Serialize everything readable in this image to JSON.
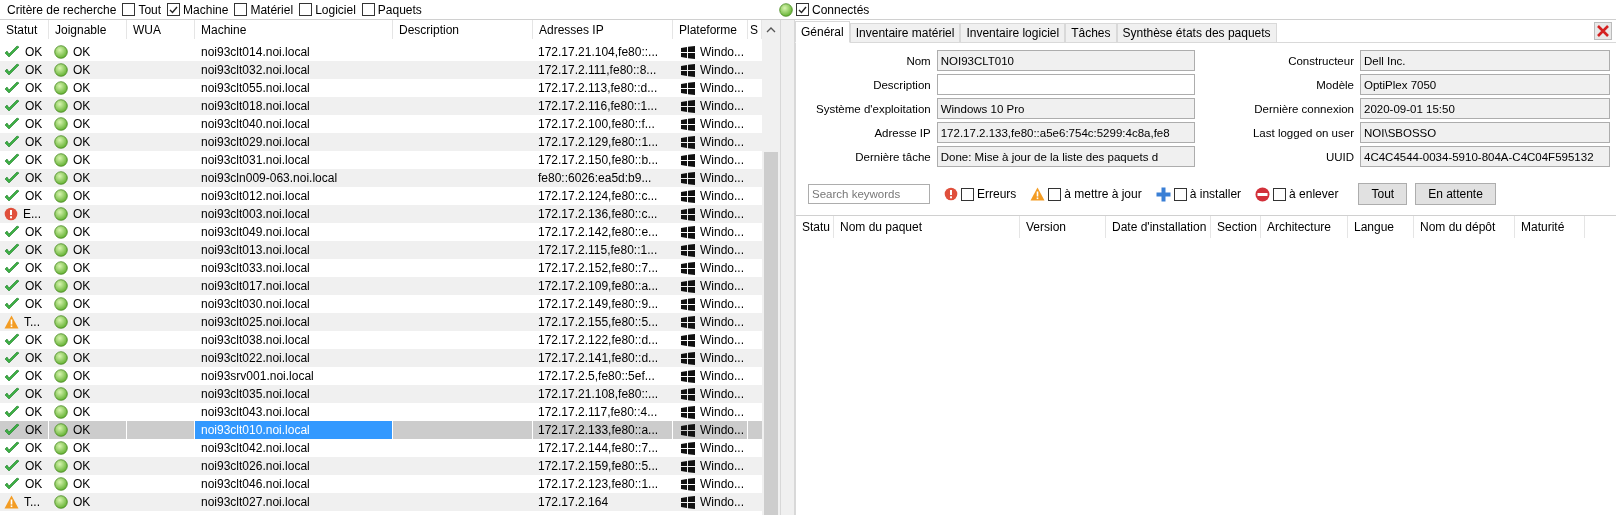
{
  "search_criteria": {
    "label": "Critère de recherche",
    "options": [
      {
        "label": "Tout",
        "checked": false
      },
      {
        "label": "Machine",
        "checked": true
      },
      {
        "label": "Matériel",
        "checked": false
      },
      {
        "label": "Logiciel",
        "checked": false
      },
      {
        "label": "Paquets",
        "checked": false
      }
    ]
  },
  "connected_filter": {
    "label": "Connectés",
    "checked": true
  },
  "hosts_table": {
    "columns": [
      "Statut",
      "Joignable",
      "WUA",
      "Machine",
      "Description",
      "Adresses IP",
      "Plateforme",
      "S"
    ],
    "rows": [
      {
        "kind": "ok",
        "status": "OK",
        "reachable": "OK",
        "machine": "noi93clt014.noi.local",
        "ip": "172.17.21.104,fe80::...",
        "platform": "Windo...",
        "selected": false
      },
      {
        "kind": "ok",
        "status": "OK",
        "reachable": "OK",
        "machine": "noi93clt032.noi.local",
        "ip": "172.17.2.111,fe80::8...",
        "platform": "Windo...",
        "selected": false
      },
      {
        "kind": "ok",
        "status": "OK",
        "reachable": "OK",
        "machine": "noi93clt055.noi.local",
        "ip": "172.17.2.113,fe80::d...",
        "platform": "Windo...",
        "selected": false
      },
      {
        "kind": "ok",
        "status": "OK",
        "reachable": "OK",
        "machine": "noi93clt018.noi.local",
        "ip": "172.17.2.116,fe80::1...",
        "platform": "Windo...",
        "selected": false
      },
      {
        "kind": "ok",
        "status": "OK",
        "reachable": "OK",
        "machine": "noi93clt040.noi.local",
        "ip": "172.17.2.100,fe80::f...",
        "platform": "Windo...",
        "selected": false
      },
      {
        "kind": "ok",
        "status": "OK",
        "reachable": "OK",
        "machine": "noi93clt029.noi.local",
        "ip": "172.17.2.129,fe80::1...",
        "platform": "Windo...",
        "selected": false
      },
      {
        "kind": "ok",
        "status": "OK",
        "reachable": "OK",
        "machine": "noi93clt031.noi.local",
        "ip": "172.17.2.150,fe80::b...",
        "platform": "Windo...",
        "selected": false
      },
      {
        "kind": "ok",
        "status": "OK",
        "reachable": "OK",
        "machine": "noi93cln009-063.noi.local",
        "ip": "fe80::6026:ea5d:b9...",
        "platform": "Windo...",
        "selected": false
      },
      {
        "kind": "ok",
        "status": "OK",
        "reachable": "OK",
        "machine": "noi93clt012.noi.local",
        "ip": "172.17.2.124,fe80::c...",
        "platform": "Windo...",
        "selected": false
      },
      {
        "kind": "error",
        "status": "E...",
        "reachable": "OK",
        "machine": "noi93clt003.noi.local",
        "ip": "172.17.2.136,fe80::c...",
        "platform": "Windo...",
        "selected": false
      },
      {
        "kind": "ok",
        "status": "OK",
        "reachable": "OK",
        "machine": "noi93clt049.noi.local",
        "ip": "172.17.2.142,fe80::e...",
        "platform": "Windo...",
        "selected": false
      },
      {
        "kind": "ok",
        "status": "OK",
        "reachable": "OK",
        "machine": "noi93clt013.noi.local",
        "ip": "172.17.2.115,fe80::1...",
        "platform": "Windo...",
        "selected": false
      },
      {
        "kind": "ok",
        "status": "OK",
        "reachable": "OK",
        "machine": "noi93clt033.noi.local",
        "ip": "172.17.2.152,fe80::7...",
        "platform": "Windo...",
        "selected": false
      },
      {
        "kind": "ok",
        "status": "OK",
        "reachable": "OK",
        "machine": "noi93clt017.noi.local",
        "ip": "172.17.2.109,fe80::a...",
        "platform": "Windo...",
        "selected": false
      },
      {
        "kind": "ok",
        "status": "OK",
        "reachable": "OK",
        "machine": "noi93clt030.noi.local",
        "ip": "172.17.2.149,fe80::9...",
        "platform": "Windo...",
        "selected": false
      },
      {
        "kind": "warning",
        "status": "T...",
        "reachable": "OK",
        "machine": "noi93clt025.noi.local",
        "ip": "172.17.2.155,fe80::5...",
        "platform": "Windo...",
        "selected": false
      },
      {
        "kind": "ok",
        "status": "OK",
        "reachable": "OK",
        "machine": "noi93clt038.noi.local",
        "ip": "172.17.2.122,fe80::d...",
        "platform": "Windo...",
        "selected": false
      },
      {
        "kind": "ok",
        "status": "OK",
        "reachable": "OK",
        "machine": "noi93clt022.noi.local",
        "ip": "172.17.2.141,fe80::d...",
        "platform": "Windo...",
        "selected": false
      },
      {
        "kind": "ok",
        "status": "OK",
        "reachable": "OK",
        "machine": "noi93srv001.noi.local",
        "ip": "172.17.2.5,fe80::5ef...",
        "platform": "Windo...",
        "selected": false
      },
      {
        "kind": "ok",
        "status": "OK",
        "reachable": "OK",
        "machine": "noi93clt035.noi.local",
        "ip": "172.17.21.108,fe80::...",
        "platform": "Windo...",
        "selected": false
      },
      {
        "kind": "ok",
        "status": "OK",
        "reachable": "OK",
        "machine": "noi93clt043.noi.local",
        "ip": "172.17.2.117,fe80::4...",
        "platform": "Windo...",
        "selected": false
      },
      {
        "kind": "ok",
        "status": "OK",
        "reachable": "OK",
        "machine": "noi93clt010.noi.local",
        "ip": "172.17.2.133,fe80::a...",
        "platform": "Windo...",
        "selected": true
      },
      {
        "kind": "ok",
        "status": "OK",
        "reachable": "OK",
        "machine": "noi93clt042.noi.local",
        "ip": "172.17.2.144,fe80::7...",
        "platform": "Windo...",
        "selected": false
      },
      {
        "kind": "ok",
        "status": "OK",
        "reachable": "OK",
        "machine": "noi93clt026.noi.local",
        "ip": "172.17.2.159,fe80::5...",
        "platform": "Windo...",
        "selected": false
      },
      {
        "kind": "ok",
        "status": "OK",
        "reachable": "OK",
        "machine": "noi93clt046.noi.local",
        "ip": "172.17.2.123,fe80::1...",
        "platform": "Windo...",
        "selected": false
      },
      {
        "kind": "warning",
        "status": "T...",
        "reachable": "OK",
        "machine": "noi93clt027.noi.local",
        "ip": "172.17.2.164",
        "platform": "Windo...",
        "selected": false
      }
    ]
  },
  "tabs": [
    {
      "label": "Général",
      "selected": true
    },
    {
      "label": "Inventaire matériel",
      "selected": false
    },
    {
      "label": "Inventaire logiciel",
      "selected": false
    },
    {
      "label": "Tâches",
      "selected": false
    },
    {
      "label": "Synthèse états des paquets",
      "selected": false
    }
  ],
  "general": {
    "left_fields": [
      {
        "label": "Nom",
        "value": "NOI93CLT010",
        "editable": false
      },
      {
        "label": "Description",
        "editable": true
      },
      {
        "label": "Système d'exploitation",
        "value": "Windows 10 Pro",
        "editable": false
      },
      {
        "label": "Adresse IP",
        "value": "172.17.2.133,fe80::a5e6:754c:5299:4c8a,fe8",
        "editable": false
      },
      {
        "label": "Dernière tâche",
        "value": "Done: Mise à jour de la liste des paquets d",
        "editable": false
      }
    ],
    "right_fields": [
      {
        "label": "Constructeur",
        "value": "Dell Inc.",
        "editable": false
      },
      {
        "label": "Modèle",
        "value": "OptiPlex 7050",
        "editable": false
      },
      {
        "label": "Dernière connexion",
        "value": "2020-09-01 15:50",
        "editable": false
      },
      {
        "label": "Last logged on user",
        "value": "NOI\\SBOSSO",
        "editable": false
      },
      {
        "label": "UUID",
        "value": "4C4C4544-0034-5910-804A-C4C04F595132",
        "editable": false
      }
    ]
  },
  "package_filters": {
    "search": {
      "placeholder": "Search keywords"
    },
    "options": [
      {
        "kind": "error",
        "label": "Erreurs",
        "checked": false
      },
      {
        "kind": "warning",
        "label": "à mettre à jour",
        "checked": false
      },
      {
        "kind": "install",
        "label": "à installer",
        "checked": false
      },
      {
        "kind": "remove",
        "label": "à enlever",
        "checked": false
      }
    ],
    "buttons": [
      "Tout",
      "En attente"
    ]
  },
  "packages_table": {
    "columns": [
      "Statu",
      "Nom du paquet",
      "Version",
      "Date d'installation",
      "Section",
      "Architecture",
      "Langue",
      "Nom du dépôt",
      "Maturité"
    ]
  }
}
